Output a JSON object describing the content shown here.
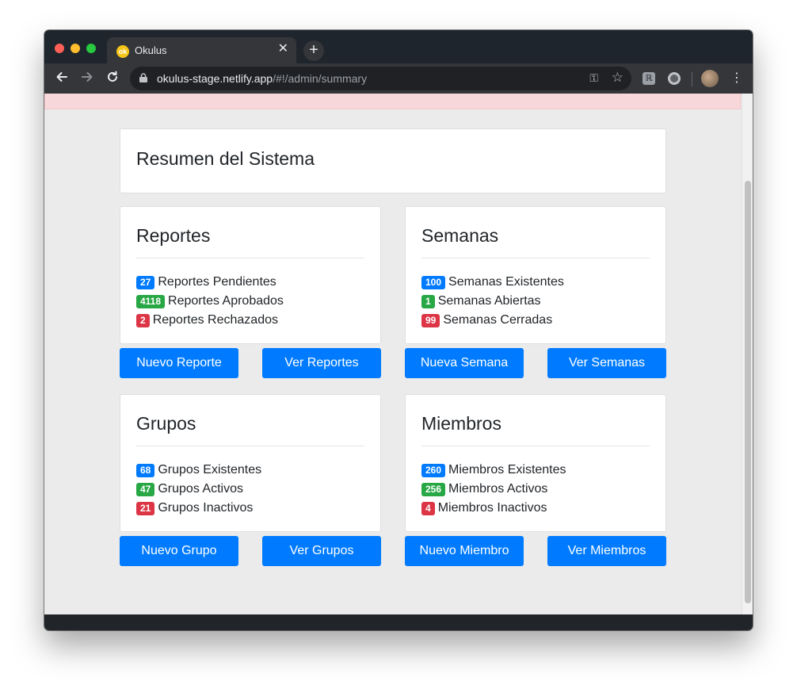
{
  "browser": {
    "tab_title": "Okulus",
    "tab_favicon_text": "ok",
    "url_host": "okulus-stage.netlify.app",
    "url_path": "/#!/admin/summary",
    "icons": [
      "back-arrow-icon",
      "forward-arrow-icon",
      "reload-icon",
      "lock-icon",
      "key-icon",
      "star-icon",
      "extension-icon",
      "menu-icon"
    ]
  },
  "page": {
    "title": "Resumen del Sistema"
  },
  "sections": {
    "reportes": {
      "title": "Reportes",
      "stats": [
        {
          "count": "27",
          "label": "Reportes Pendientes",
          "color": "#007bff"
        },
        {
          "count": "4118",
          "label": "Reportes Aprobados",
          "color": "#28a745"
        },
        {
          "count": "2",
          "label": "Reportes Rechazados",
          "color": "#dc3545"
        }
      ],
      "primary_button": "Nuevo Reporte",
      "secondary_button": "Ver Reportes"
    },
    "semanas": {
      "title": "Semanas",
      "stats": [
        {
          "count": "100",
          "label": "Semanas Existentes",
          "color": "#007bff"
        },
        {
          "count": "1",
          "label": "Semanas Abiertas",
          "color": "#28a745"
        },
        {
          "count": "99",
          "label": "Semanas Cerradas",
          "color": "#dc3545"
        }
      ],
      "primary_button": "Nueva Semana",
      "secondary_button": "Ver Semanas"
    },
    "grupos": {
      "title": "Grupos",
      "stats": [
        {
          "count": "68",
          "label": "Grupos Existentes",
          "color": "#007bff"
        },
        {
          "count": "47",
          "label": "Grupos Activos",
          "color": "#28a745"
        },
        {
          "count": "21",
          "label": "Grupos Inactivos",
          "color": "#dc3545"
        }
      ],
      "primary_button": "Nuevo Grupo",
      "secondary_button": "Ver Grupos"
    },
    "miembros": {
      "title": "Miembros",
      "stats": [
        {
          "count": "260",
          "label": "Miembros Existentes",
          "color": "#007bff"
        },
        {
          "count": "256",
          "label": "Miembros Activos",
          "color": "#28a745"
        },
        {
          "count": "4",
          "label": "Miembros Inactivos",
          "color": "#dc3545"
        }
      ],
      "primary_button": "Nuevo Miembro",
      "secondary_button": "Ver Miembros"
    }
  },
  "colors": {
    "primary": "#007bff",
    "success": "#28a745",
    "danger": "#dc3545",
    "alert_background": "#f8d7da"
  }
}
